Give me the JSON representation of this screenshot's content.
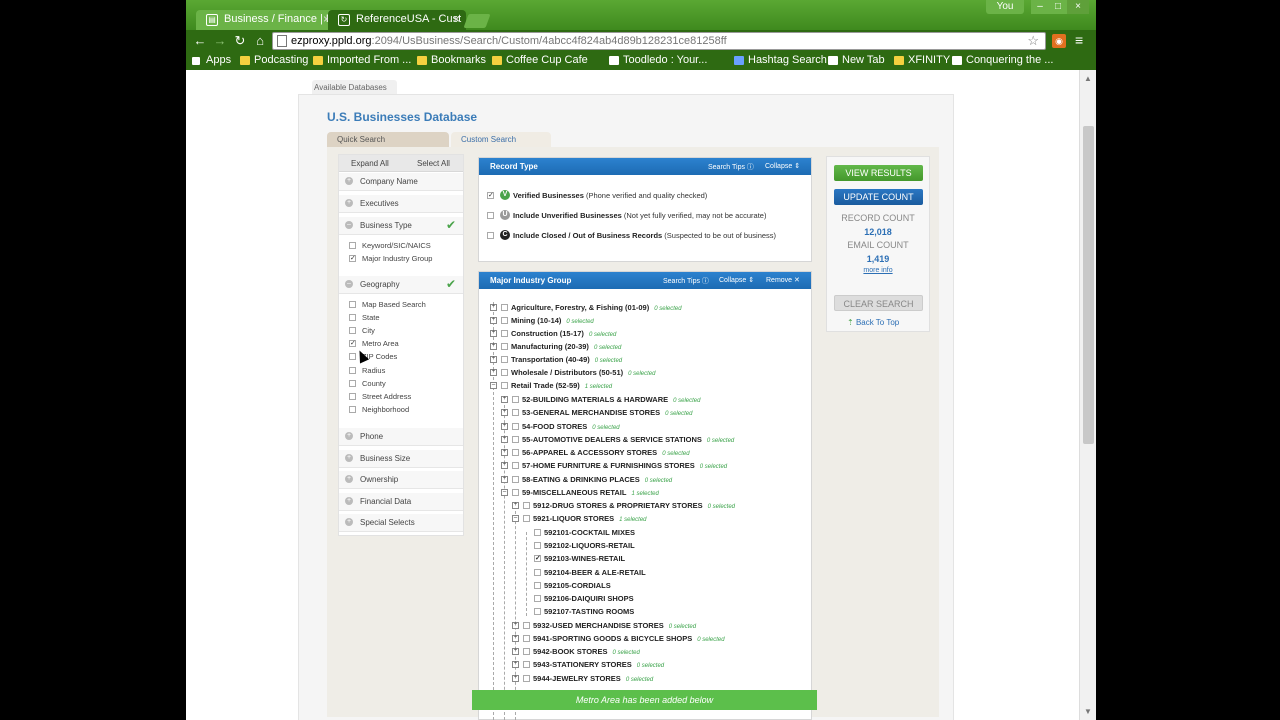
{
  "browser": {
    "tabs": [
      {
        "label": "Business / Finance | F",
        "active": false
      },
      {
        "label": "ReferenceUSA - Cust",
        "active": true
      }
    ],
    "user_badge": "You",
    "url_host": "ezproxy.ppld.org",
    "url_rest": ":2094/UsBusiness/Search/Custom/4abcc4f824ab4d89b128231ce81258ff",
    "bookmarks": [
      "Apps",
      "Podcasting",
      "Imported From ...",
      "Bookmarks",
      "Coffee Cup Cafe",
      "Toodledo : Your...",
      "Hashtag Search",
      "New Tab",
      "XFINITY",
      "Conquering the ..."
    ]
  },
  "page": {
    "available_databases": "Available Databases",
    "db_title": "U.S. Businesses Database",
    "tabs": {
      "quick": "Quick Search",
      "custom": "Custom Search"
    },
    "leftnav": {
      "expand_all": "Expand All",
      "select_all": "Select All",
      "sections": [
        "Company Name",
        "Executives",
        "Business Type",
        "Geography",
        "Phone",
        "Business Size",
        "Ownership",
        "Financial Data",
        "Special Selects"
      ],
      "business_type_items": [
        {
          "label": "Keyword/SIC/NAICS",
          "checked": false
        },
        {
          "label": "Major Industry Group",
          "checked": true
        }
      ],
      "geography_items": [
        {
          "label": "Map Based Search",
          "checked": false
        },
        {
          "label": "State",
          "checked": false
        },
        {
          "label": "City",
          "checked": false
        },
        {
          "label": "Metro Area",
          "checked": true
        },
        {
          "label": "ZIP Codes",
          "checked": false
        },
        {
          "label": "Radius",
          "checked": false
        },
        {
          "label": "County",
          "checked": false
        },
        {
          "label": "Street Address",
          "checked": false
        },
        {
          "label": "Neighborhood",
          "checked": false
        }
      ]
    },
    "record_type": {
      "title": "Record Type",
      "search_tips": "Search Tips",
      "collapse": "Collapse",
      "rows": [
        {
          "badge": "V",
          "label": "Verified Businesses",
          "note": "(Phone verified and quality checked)",
          "checked": true,
          "color": "#4aa34a"
        },
        {
          "badge": "U",
          "label": "Include Unverified Businesses",
          "note": "(Not yet fully verified, may not be accurate)",
          "checked": false,
          "color": "#999999"
        },
        {
          "badge": "C",
          "label": "Include Closed / Out of Business Records",
          "note": "(Suspected to be out of business)",
          "checked": false,
          "color": "#222222"
        }
      ]
    },
    "major_group": {
      "title": "Major Industry Group",
      "search_tips": "Search Tips",
      "collapse": "Collapse",
      "remove": "Remove",
      "tree": [
        {
          "label": "Agriculture, Forestry, & Fishing (01-09)",
          "sel": "0 selected"
        },
        {
          "label": "Mining (10-14)",
          "sel": "0 selected"
        },
        {
          "label": "Construction (15-17)",
          "sel": "0 selected"
        },
        {
          "label": "Manufacturing (20-39)",
          "sel": "0 selected"
        },
        {
          "label": "Transportation (40-49)",
          "sel": "0 selected"
        },
        {
          "label": "Wholesale / Distributors (50-51)",
          "sel": "0 selected"
        },
        {
          "label": "Retail Trade (52-59)",
          "sel": "1 selected"
        },
        {
          "label": "52-BUILDING MATERIALS & HARDWARE",
          "sel": "0 selected"
        },
        {
          "label": "53-GENERAL MERCHANDISE STORES",
          "sel": "0 selected"
        },
        {
          "label": "54-FOOD STORES",
          "sel": "0 selected"
        },
        {
          "label": "55-AUTOMOTIVE DEALERS & SERVICE STATIONS",
          "sel": "0 selected"
        },
        {
          "label": "56-APPAREL & ACCESSORY STORES",
          "sel": "0 selected"
        },
        {
          "label": "57-HOME FURNITURE & FURNISHINGS STORES",
          "sel": "0 selected"
        },
        {
          "label": "58-EATING & DRINKING PLACES",
          "sel": "0 selected"
        },
        {
          "label": "59-MISCELLANEOUS RETAIL",
          "sel": "1 selected"
        },
        {
          "label": "5912-DRUG STORES & PROPRIETARY STORES",
          "sel": "0 selected"
        },
        {
          "label": "5921-LIQUOR STORES",
          "sel": "1 selected"
        },
        {
          "label": "592101-COCKTAIL MIXES",
          "sel": ""
        },
        {
          "label": "592102-LIQUORS-RETAIL",
          "sel": ""
        },
        {
          "label": "592103-WINES-RETAIL",
          "sel": ""
        },
        {
          "label": "592104-BEER & ALE-RETAIL",
          "sel": ""
        },
        {
          "label": "592105-CORDIALS",
          "sel": ""
        },
        {
          "label": "592106-DAIQUIRI SHOPS",
          "sel": ""
        },
        {
          "label": "592107-TASTING ROOMS",
          "sel": ""
        },
        {
          "label": "5932-USED MERCHANDISE STORES",
          "sel": "0 selected"
        },
        {
          "label": "5941-SPORTING GOODS & BICYCLE SHOPS",
          "sel": "0 selected"
        },
        {
          "label": "5942-BOOK STORES",
          "sel": "0 selected"
        },
        {
          "label": "5943-STATIONERY STORES",
          "sel": "0 selected"
        },
        {
          "label": "5944-JEWELRY STORES",
          "sel": "0 selected"
        }
      ]
    },
    "actions": {
      "view_results": "VIEW RESULTS",
      "update_count": "UPDATE COUNT",
      "record_count_label": "RECORD COUNT",
      "record_count": "12,018",
      "email_count_label": "EMAIL COUNT",
      "email_count": "1,419",
      "more_info": "more info",
      "clear_search": "CLEAR SEARCH",
      "back_to_top": "Back To Top"
    },
    "notification": "Metro Area has been added below"
  }
}
